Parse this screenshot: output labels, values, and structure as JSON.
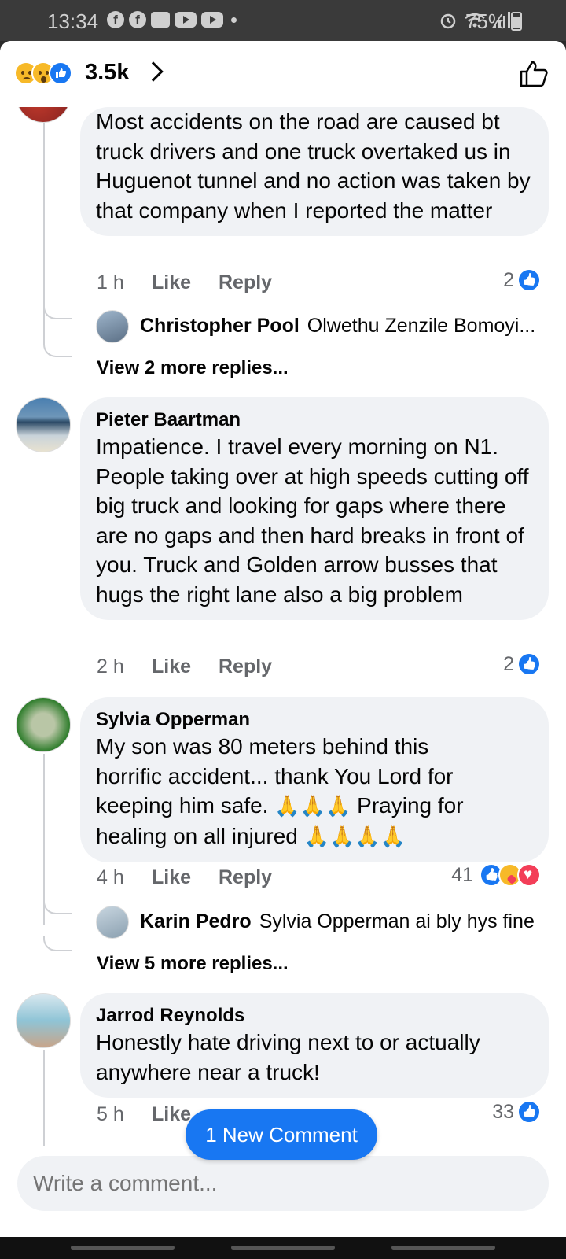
{
  "status_bar": {
    "time": "13:34",
    "battery": "75%",
    "icons": [
      "facebook-icon",
      "facebook-icon",
      "download-icon",
      "youtube-icon",
      "youtube-icon",
      "dot-icon",
      "alarm-icon",
      "wifi-icon",
      "signal-icon",
      "battery-icon"
    ]
  },
  "header": {
    "reaction_count": "3.5k",
    "reactions": [
      "sad",
      "wow",
      "like"
    ]
  },
  "comments": [
    {
      "text": "Most accidents on the road are caused bt truck drivers and one truck overtaked us in Huguenot tunnel and no action was taken by that company when I reported the matter",
      "time": "1 h",
      "like_label": "Like",
      "reply_label": "Reply",
      "reaction_count": "2",
      "reply_preview": {
        "author": "Christopher Pool",
        "text": "Olwethu Zenzile Bomoyi..."
      },
      "view_more": "View 2 more replies..."
    },
    {
      "author": "Pieter Baartman",
      "text": "Impatience. I travel every morning on N1. People taking over at high speeds cutting off big truck and looking for gaps where there are no gaps and then hard breaks in front of you. Truck and Golden arrow busses that hugs the right lane also a big problem",
      "time": "2 h",
      "like_label": "Like",
      "reply_label": "Reply",
      "reaction_count": "2"
    },
    {
      "author": "Sylvia Opperman",
      "text_line1": "My son was 80 meters behind this",
      "text_line2": "horrific accident... thank You Lord for",
      "text_line3a": "keeping him safe.",
      "text_line3b": "Praying for",
      "text_line4": "healing on all injured",
      "pray_emoji": "🙏",
      "time": "4 h",
      "like_label": "Like",
      "reply_label": "Reply",
      "reaction_count": "41",
      "reply_preview": {
        "author": "Karin Pedro",
        "text": "Sylvia Opperman ai bly hys fine"
      },
      "view_more": "View 5 more replies..."
    },
    {
      "author": "Jarrod Reynolds",
      "text": "Honestly hate driving next to or actually anywhere near a truck!",
      "time": "5 h",
      "like_label": "Like",
      "reaction_count": "33"
    }
  ],
  "new_comment_pill": "1 New Comment",
  "composer": {
    "placeholder": "Write a comment..."
  },
  "colors": {
    "accent": "#1877f2",
    "bubble": "#f0f2f5",
    "meta": "#65676b"
  }
}
